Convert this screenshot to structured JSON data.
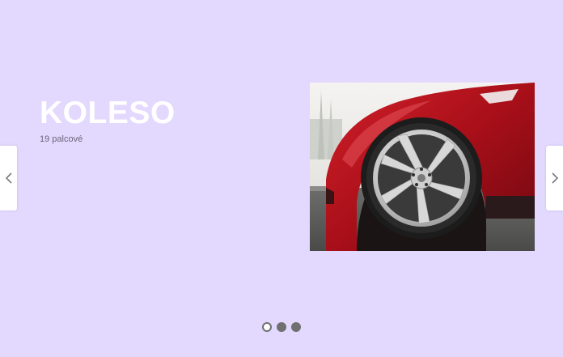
{
  "slide": {
    "title": "KOLESO",
    "subtitle": "19 palcové"
  },
  "navigation": {
    "prev_icon": "chevron-left-icon",
    "next_icon": "chevron-right-icon"
  },
  "pagination": {
    "total": 3,
    "active_index": 0
  },
  "colors": {
    "background": "#e3d8fe",
    "arrow_bg": "#ffffff",
    "dot": "#707070",
    "car_body": "#b0121c"
  }
}
